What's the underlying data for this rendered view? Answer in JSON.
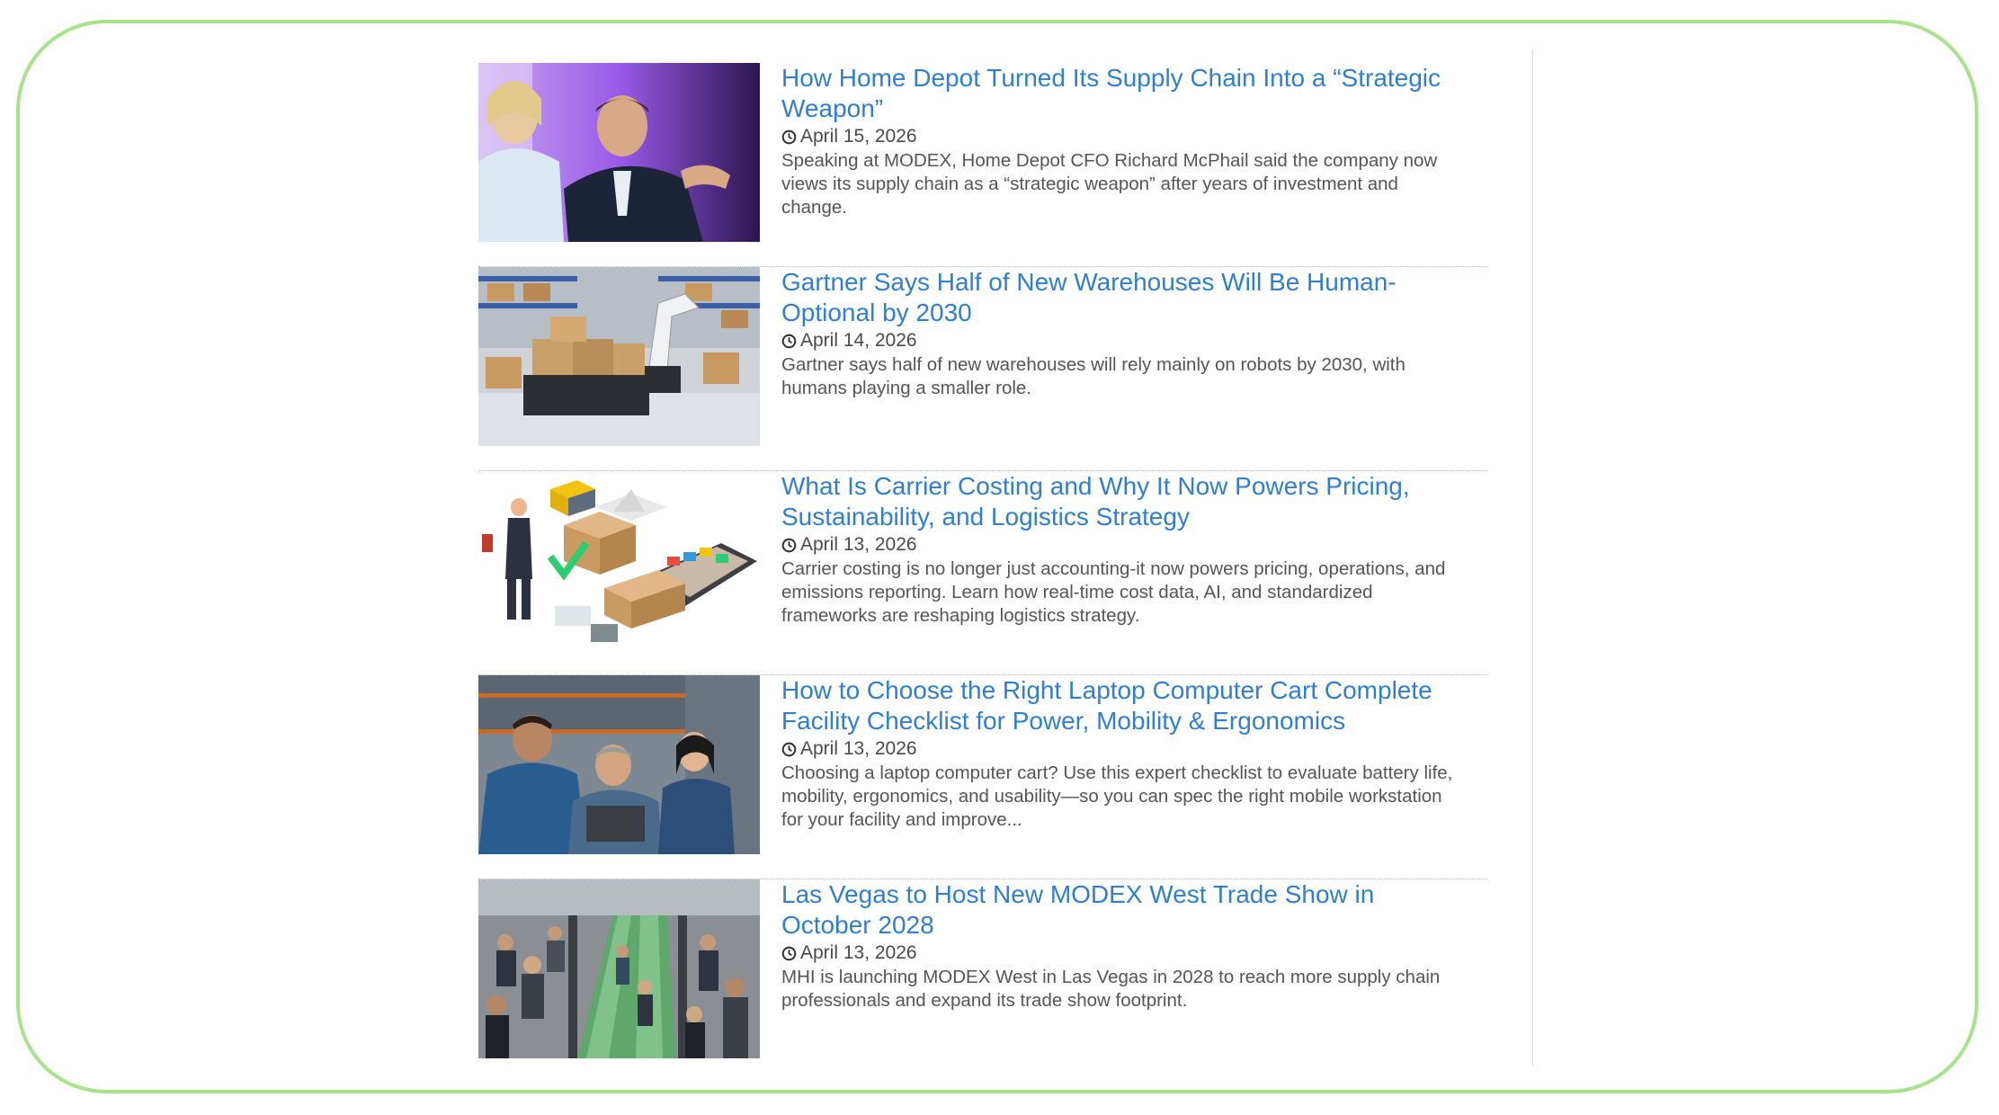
{
  "articles": [
    {
      "title": "How Home Depot Turned Its Supply Chain Into a “Strategic Weapon”",
      "date": "April 15, 2026",
      "summary": "Speaking at MODEX, Home Depot CFO Richard McPhail said the company now views its supply chain as a “strategic weapon” after years of investment and change.",
      "image": "two executives on stage"
    },
    {
      "title": "Gartner Says Half of New Warehouses Will Be Human-Optional by 2030",
      "date": "April 14, 2026",
      "summary": "Gartner says half of new warehouses will rely mainly on robots by 2030, with humans playing a smaller role.",
      "image": "warehouse robot with boxes"
    },
    {
      "title": "What Is Carrier Costing and Why It Now Powers Pricing, Sustainability, and Logistics Strategy",
      "date": "April 13, 2026",
      "summary": "Carrier costing is no longer just accounting-it now powers pricing, operations, and emissions reporting. Learn how real-time cost data, AI, and standardized frameworks are reshaping logistics strategy.",
      "image": "isometric logistics illustration"
    },
    {
      "title": "How to Choose the Right Laptop Computer Cart Complete Facility Checklist for Power, Mobility & Ergonomics",
      "date": "April 13, 2026",
      "summary": "Choosing a laptop computer cart? Use this expert checklist to evaluate battery life, mobility, ergonomics, and usability—so you can spec the right mobile workstation for your facility and improve...",
      "image": "workers with laptop in warehouse"
    },
    {
      "title": "Las Vegas to Host New MODEX West Trade Show in October 2028",
      "date": "April 13, 2026",
      "summary": "MHI is launching MODEX West in Las Vegas in 2028 to reach more supply chain professionals and expand its trade show footprint.",
      "image": "crowd on escalators at trade show"
    }
  ]
}
